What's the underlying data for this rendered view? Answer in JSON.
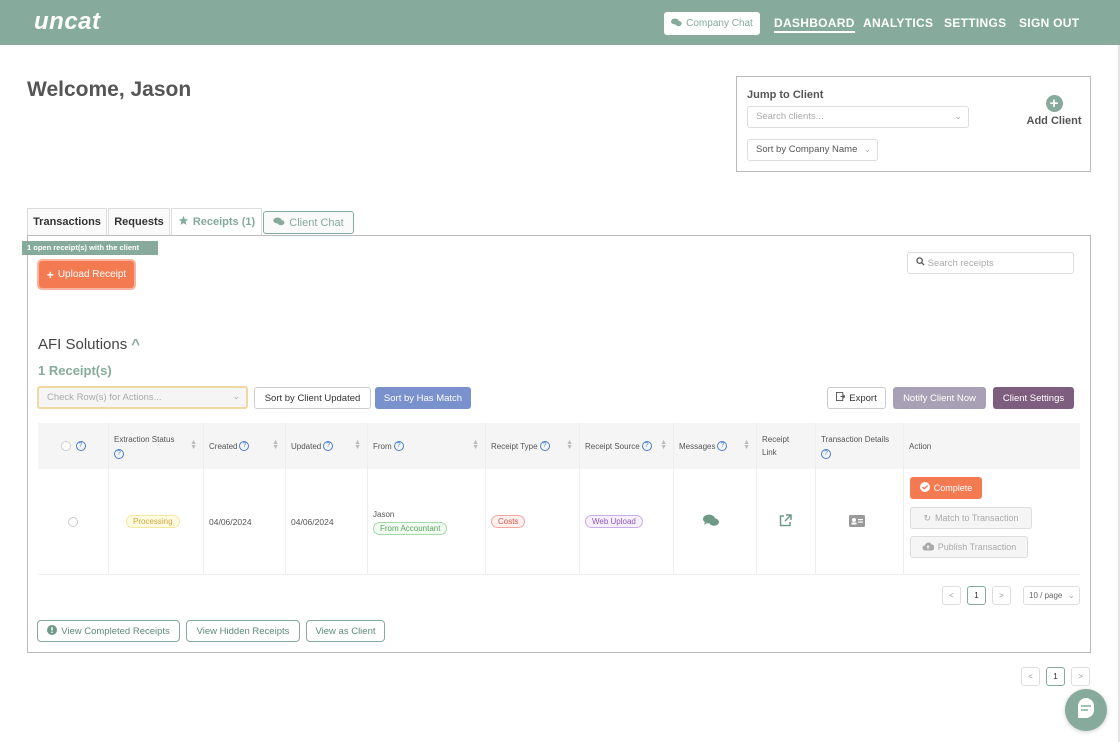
{
  "header": {
    "logo": "uncat",
    "company_chat": "Company Chat",
    "nav": [
      "DASHBOARD",
      "ANALYTICS",
      "SETTINGS",
      "SIGN OUT"
    ],
    "accent": "#86ab9c"
  },
  "welcome": "Welcome, Jason",
  "jump": {
    "title": "Jump to Client",
    "search_placeholder": "Search clients...",
    "sort_label": "Sort by Company Name",
    "add_client": "Add Client"
  },
  "tabs": {
    "transactions": "Transactions",
    "requests": "Requests",
    "receipts": "Receipts (1)",
    "client_chat": "Client Chat"
  },
  "panel": {
    "ribbon": "1 open receipt(s) with the client",
    "upload": "Upload Receipt",
    "search_placeholder": "Search receipts",
    "client_name": "AFI Solutions",
    "receipt_count": "1 Receipt(s)",
    "check_rows_placeholder": "Check Row(s) for Actions...",
    "sort_client_updated": "Sort by Client Updated",
    "sort_has_match": "Sort by Has Match",
    "export": "Export",
    "notify": "Notify Client Now",
    "client_settings": "Client Settings"
  },
  "table": {
    "headers": {
      "extraction": "Extraction Status",
      "created": "Created",
      "updated": "Updated",
      "from": "From",
      "receipt_type": "Receipt Type",
      "receipt_source": "Receipt Source",
      "messages": "Messages",
      "receipt_link": "Receipt Link",
      "transaction_details": "Transaction Details",
      "action": "Action"
    },
    "row": {
      "status": "Processing",
      "created": "04/06/2024",
      "updated": "04/06/2024",
      "from_name": "Jason",
      "from_badge": "From Accountant",
      "type": "Costs",
      "source": "Web Upload",
      "complete": "Complete",
      "match": "Match to Transaction",
      "publish": "Publish Transaction"
    }
  },
  "pagination": {
    "page": "1",
    "per_page": "10 / page"
  },
  "footer_buttons": {
    "completed": "View Completed Receipts",
    "hidden": "View Hidden Receipts",
    "as_client": "View as Client"
  },
  "outer_page": "1"
}
